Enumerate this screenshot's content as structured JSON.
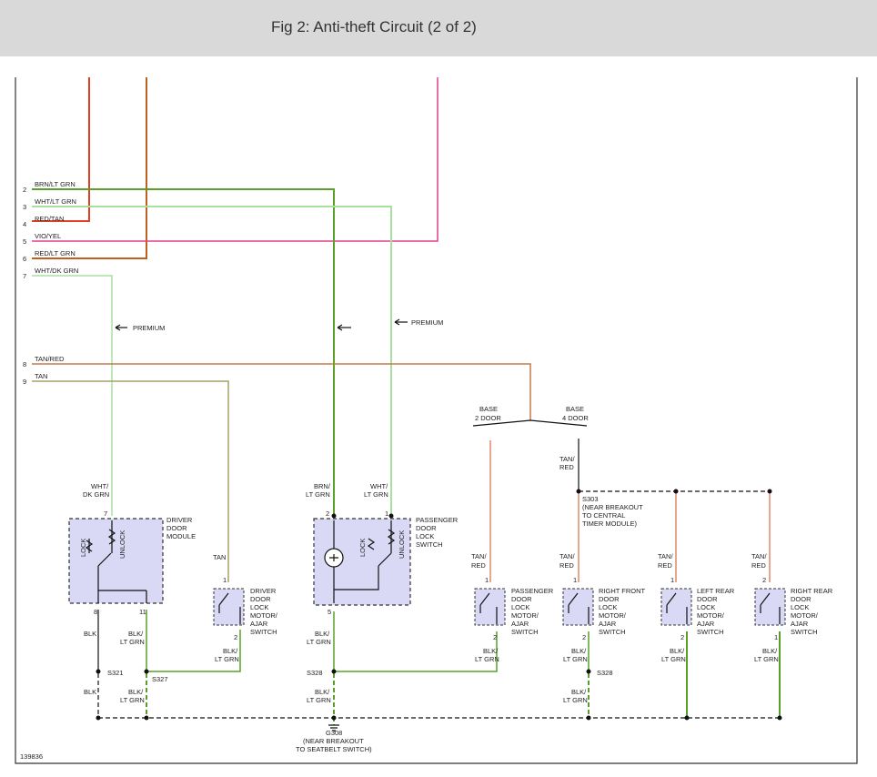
{
  "header": {
    "title": "Fig 2: Anti-theft Circuit (2 of 2)"
  },
  "colors": {
    "red": "#e04020",
    "brown": "#c06020",
    "magenta": "#e0408a",
    "green": "#58a028",
    "lightgreen": "#a8e0a0",
    "olive": "#a8a068",
    "tanred": "#c87848",
    "salmon": "#e08868"
  },
  "wires_left": [
    {
      "pin": "2",
      "label": "BRN/LT GRN"
    },
    {
      "pin": "3",
      "label": "WHT/LT GRN"
    },
    {
      "pin": "4",
      "label": "RED/TAN"
    },
    {
      "pin": "5",
      "label": "VIO/YEL"
    },
    {
      "pin": "6",
      "label": "RED/LT GRN"
    },
    {
      "pin": "7",
      "label": "WHT/DK GRN"
    },
    {
      "pin": "8",
      "label": "TAN/RED"
    },
    {
      "pin": "9",
      "label": "TAN"
    }
  ],
  "premium": "PREMIUM",
  "base_2door": [
    "BASE",
    "2 DOOR"
  ],
  "base_4door": [
    "BASE",
    "4 DOOR"
  ],
  "tan_red": [
    "TAN/",
    "RED"
  ],
  "tan": "TAN",
  "wht_dk_grn": [
    "WHT/",
    "DK GRN"
  ],
  "brn_lt_grn": [
    "BRN/",
    "LT GRN"
  ],
  "wht_lt_grn": [
    "WHT/",
    "LT GRN"
  ],
  "blk": "BLK",
  "blk_lt_grn": [
    "BLK/",
    "LT GRN"
  ],
  "lock": "LOCK",
  "unlock": "UNLOCK",
  "driver_door_module": [
    "DRIVER",
    "DOOR",
    "MODULE"
  ],
  "driver_switch": [
    "DRIVER",
    "DOOR",
    "LOCK",
    "MOTOR/",
    "AJAR",
    "SWITCH"
  ],
  "passenger_lock_switch": [
    "PASSENGER",
    "DOOR",
    "LOCK",
    "SWITCH"
  ],
  "passenger_switch": [
    "PASSENGER",
    "DOOR",
    "LOCK",
    "MOTOR/",
    "AJAR",
    "SWITCH"
  ],
  "right_front_switch": [
    "RIGHT FRONT",
    "DOOR",
    "LOCK",
    "MOTOR/",
    "AJAR",
    "SWITCH"
  ],
  "left_rear_switch": [
    "LEFT REAR",
    "DOOR",
    "LOCK",
    "MOTOR/",
    "AJAR",
    "SWITCH"
  ],
  "right_rear_switch": [
    "RIGHT REAR",
    "DOOR",
    "LOCK",
    "MOTOR/",
    "AJAR",
    "SWITCH"
  ],
  "splices": {
    "s321": "S321",
    "s327": "S327",
    "s328": "S328"
  },
  "s303": [
    "S303",
    "(NEAR BREAKOUT",
    "TO CENTRAL",
    "TIMER MODULE)"
  ],
  "g308": [
    "G308",
    "(NEAR BREAKOUT",
    "TO SEATBELT SWITCH)"
  ],
  "pins": {
    "p7": "7",
    "p8": "8",
    "p11": "11",
    "p1": "1",
    "p2": "2",
    "p5": "5"
  },
  "figure_id": "139836"
}
